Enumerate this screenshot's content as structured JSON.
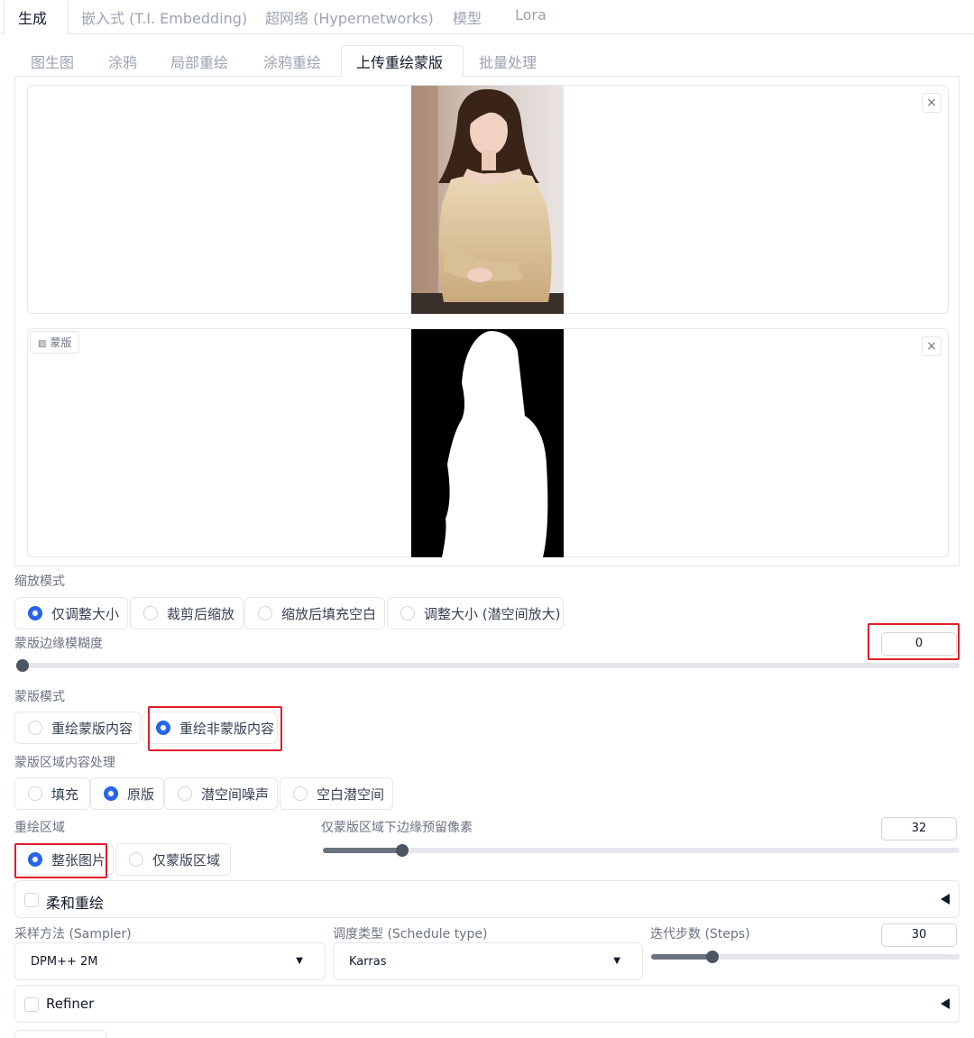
{
  "top_tabs": [
    "生成",
    "嵌入式 (T.I. Embedding)",
    "超网络 (Hypernetworks)",
    "模型",
    "Lora"
  ],
  "sub_tabs": [
    "图生图",
    "涂鸦",
    "局部重绘",
    "涂鸦重绘",
    "上传重绘蒙版",
    "批量处理"
  ],
  "image_panel": {
    "close": "×"
  },
  "mask_panel": {
    "label": "蒙版",
    "close": "×"
  },
  "resize_mode": {
    "label": "缩放模式",
    "options": [
      "仅调整大小",
      "裁剪后缩放",
      "缩放后填充空白",
      "调整大小 (潜空间放大)"
    ],
    "selected": 0
  },
  "mask_blur": {
    "label": "蒙版边缘模糊度",
    "value": "0",
    "fraction": 0.0
  },
  "mask_mode": {
    "label": "蒙版模式",
    "options": [
      "重绘蒙版内容",
      "重绘非蒙版内容"
    ],
    "selected": 1
  },
  "masked_content": {
    "label": "蒙版区域内容处理",
    "options": [
      "填充",
      "原版",
      "潜空间噪声",
      "空白潜空间"
    ],
    "selected": 1
  },
  "inpaint_area": {
    "label": "重绘区域",
    "options": [
      "整张图片",
      "仅蒙版区域"
    ],
    "selected": 0
  },
  "padding": {
    "label": "仅蒙版区域下边缘预留像素",
    "value": "32",
    "fraction": 0.125
  },
  "soft_inpaint": {
    "label": "柔和重绘"
  },
  "sampler": {
    "label": "采样方法 (Sampler)",
    "value": "DPM++ 2M"
  },
  "schedule": {
    "label": "调度类型 (Schedule type)",
    "value": "Karras"
  },
  "steps": {
    "label": "迭代步数 (Steps)",
    "value": "30",
    "fraction": 0.2
  },
  "refiner": {
    "label": "Refiner"
  },
  "colors": {
    "accent": "#2563eb",
    "highlight": "#e11d2a"
  }
}
